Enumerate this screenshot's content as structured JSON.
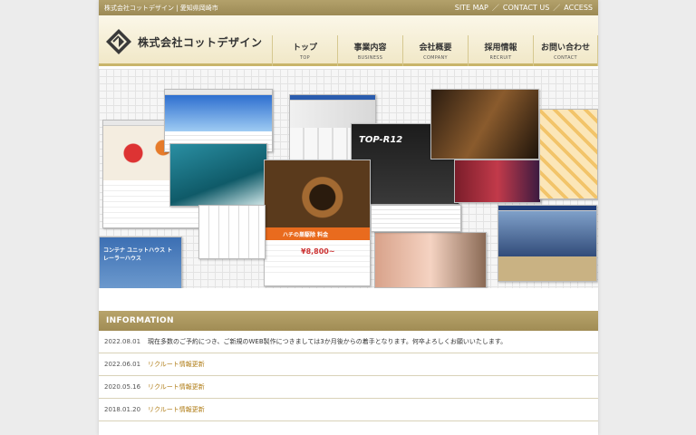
{
  "topbar": {
    "company_area": "株式会社コットデザイン | 愛知県岡崎市",
    "links": [
      "SITE MAP",
      "CONTACT US",
      "ACCESS"
    ],
    "separator": "／"
  },
  "header": {
    "logo_text": "株式会社コットデザイン",
    "nav": [
      {
        "ja": "トップ",
        "en": "TOP"
      },
      {
        "ja": "事業内容",
        "en": "BUSINESS"
      },
      {
        "ja": "会社概要",
        "en": "COMPANY"
      },
      {
        "ja": "採用情報",
        "en": "RECRUIT"
      },
      {
        "ja": "お問い合わせ",
        "en": "CONTACT"
      }
    ]
  },
  "hero": {
    "labels": {
      "container": "コンテナ ユニットハウス トレーラーハウス",
      "hachi": "ハチの巣駆除 料金",
      "price": "¥8,800~",
      "rc": "TOP-R12"
    }
  },
  "info": {
    "title": "INFORMATION",
    "items": [
      {
        "date": "2022.08.01",
        "text": "現在多数のご予約につき、ご新規のWEB製作につきましては3か月後からの着手となります。何卒よろしくお願いいたします。",
        "link": false
      },
      {
        "date": "2022.06.01",
        "text": "リクルート情報更新",
        "link": true
      },
      {
        "date": "2020.05.16",
        "text": "リクルート情報更新",
        "link": true
      },
      {
        "date": "2018.01.20",
        "text": "リクルート情報更新",
        "link": true
      }
    ]
  },
  "colors": {
    "gold": "#b3a16b",
    "link": "#b07d17"
  }
}
